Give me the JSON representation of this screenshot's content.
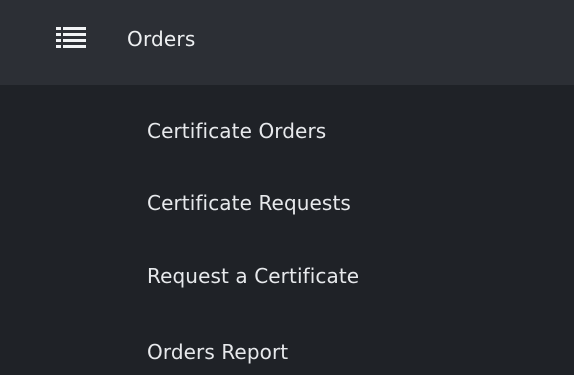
{
  "menu": {
    "header": {
      "icon": "list-icon",
      "label": "Orders"
    },
    "items": [
      {
        "label": "Certificate Orders"
      },
      {
        "label": "Certificate Requests"
      },
      {
        "label": "Request a Certificate"
      },
      {
        "label": "Orders Report"
      }
    ]
  },
  "colors": {
    "header_background": "#2c2f35",
    "menu_background": "#1f2227",
    "text": "#e9ebee"
  }
}
